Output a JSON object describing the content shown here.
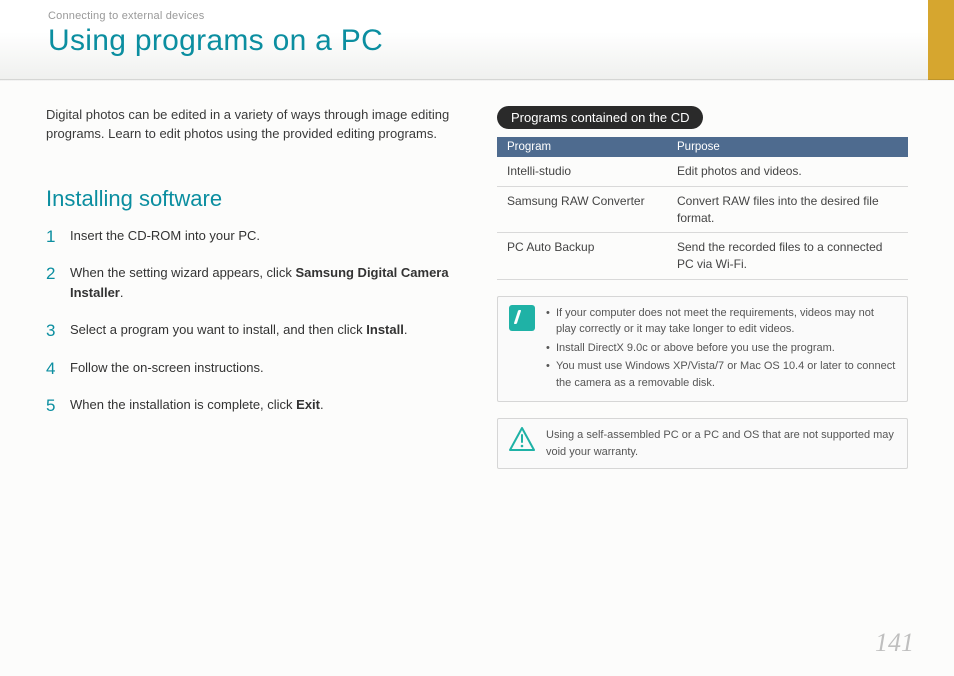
{
  "header": {
    "breadcrumb": "Connecting to external devices",
    "title": "Using programs on a PC"
  },
  "left": {
    "intro": "Digital photos can be edited in a variety of ways through image editing programs. Learn to edit photos using the provided editing programs.",
    "section_title": "Installing software",
    "steps": {
      "s1": "Insert the CD-ROM into your PC.",
      "s2a": "When the setting wizard appears, click ",
      "s2b": "Samsung Digital Camera Installer",
      "s2c": ".",
      "s3a": "Select a program you want to install, and then click ",
      "s3b": "Install",
      "s3c": ".",
      "s4": "Follow the on-screen instructions.",
      "s5a": "When the installation is complete, click ",
      "s5b": "Exit",
      "s5c": "."
    }
  },
  "right": {
    "pill": "Programs contained on the CD",
    "table": {
      "head_program": "Program",
      "head_purpose": "Purpose",
      "rows": [
        {
          "program": "Intelli-studio",
          "purpose": "Edit photos and videos."
        },
        {
          "program": "Samsung RAW Converter",
          "purpose": "Convert RAW files into the desired file format."
        },
        {
          "program": "PC Auto Backup",
          "purpose": "Send the recorded files to a connected PC via Wi-Fi."
        }
      ]
    },
    "note": {
      "n1": "If your computer does not meet the requirements, videos may not play correctly or it may take longer to edit videos.",
      "n2": "Install DirectX 9.0c or above before you use the program.",
      "n3": "You must use Windows XP/Vista/7 or Mac OS 10.4 or later to connect the camera as a removable disk."
    },
    "warn": "Using a self-assembled PC or a PC and OS that are not supported may void your warranty."
  },
  "page_number": "141"
}
